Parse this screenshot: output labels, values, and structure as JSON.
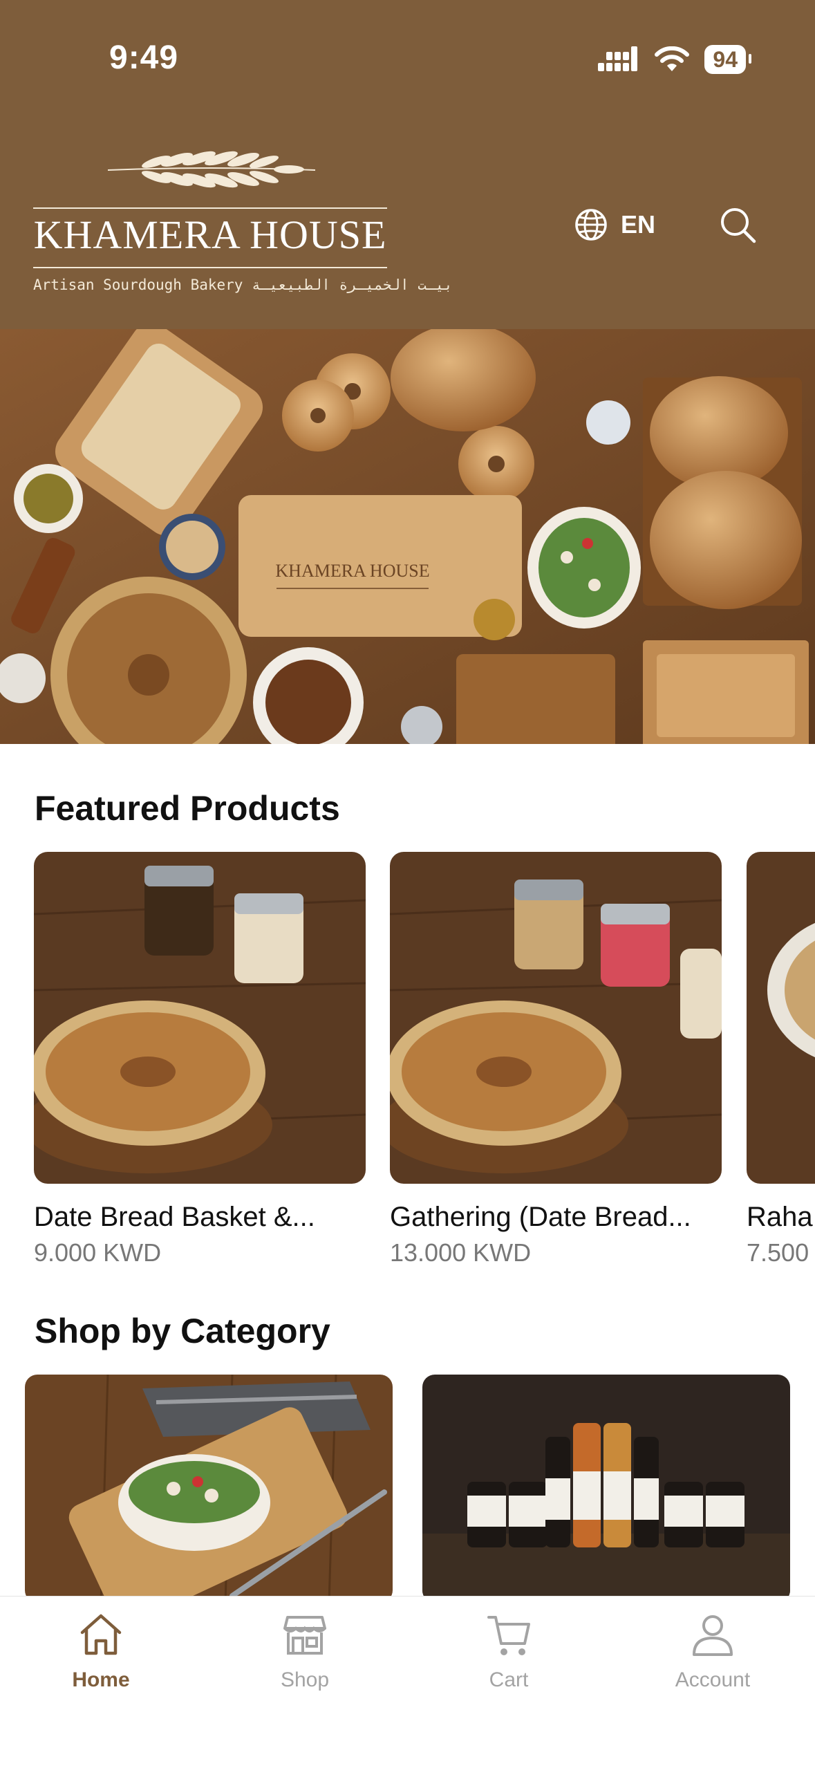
{
  "status_bar": {
    "time": "9:49",
    "battery": "94"
  },
  "header": {
    "brand_name": "KHAMERA HOUSE",
    "brand_tagline": "Artisan Sourdough Bakery بيـت الخميـرة الطبيعيـة",
    "language": "EN"
  },
  "hero": {
    "board_text": "KHAMERA HOUSE"
  },
  "featured": {
    "title": "Featured Products",
    "items": [
      {
        "name": "Date Bread Basket &...",
        "price": "9.000 KWD"
      },
      {
        "name": "Gathering (Date Bread...",
        "price": "13.000 KWD"
      },
      {
        "name": "Raha",
        "price": "7.500"
      }
    ]
  },
  "categories": {
    "title": "Shop by Category"
  },
  "tabbar": {
    "items": [
      {
        "label": "Home",
        "icon": "home-icon",
        "active": true
      },
      {
        "label": "Shop",
        "icon": "shop-icon",
        "active": false
      },
      {
        "label": "Cart",
        "icon": "cart-icon",
        "active": false
      },
      {
        "label": "Account",
        "icon": "account-icon",
        "active": false
      }
    ]
  },
  "colors": {
    "brand": "#7e5d3b",
    "inactive": "#a3a3a3"
  }
}
